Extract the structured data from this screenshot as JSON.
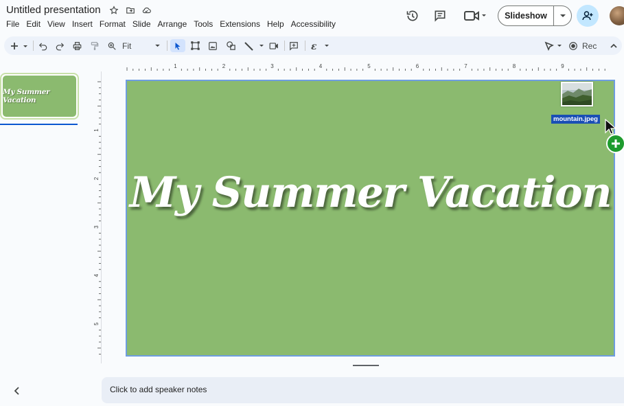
{
  "header": {
    "doc_title": "Untitled presentation",
    "menu": [
      "File",
      "Edit",
      "View",
      "Insert",
      "Format",
      "Slide",
      "Arrange",
      "Tools",
      "Extensions",
      "Help",
      "Accessibility"
    ],
    "slideshow_label": "Slideshow"
  },
  "toolbar": {
    "zoom_value": "Fit",
    "rec_label": "Rec"
  },
  "ruler": {
    "horizontal": [
      "1",
      "2",
      "3",
      "4",
      "5",
      "6",
      "7",
      "8",
      "9"
    ],
    "vertical": [
      "1",
      "2",
      "3",
      "4",
      "5"
    ]
  },
  "slide_panel": {
    "thumb_title": "My Summer Vacation"
  },
  "slide": {
    "title": "My Summer Vacation",
    "background": "#8bba6f"
  },
  "drag": {
    "filename": "mountain.jpeg"
  },
  "notes": {
    "placeholder": "Click to add speaker notes"
  },
  "colors": {
    "accent": "#0b57d0",
    "share_bg": "#c2e7ff",
    "drop_add": "#1e9b2e"
  }
}
